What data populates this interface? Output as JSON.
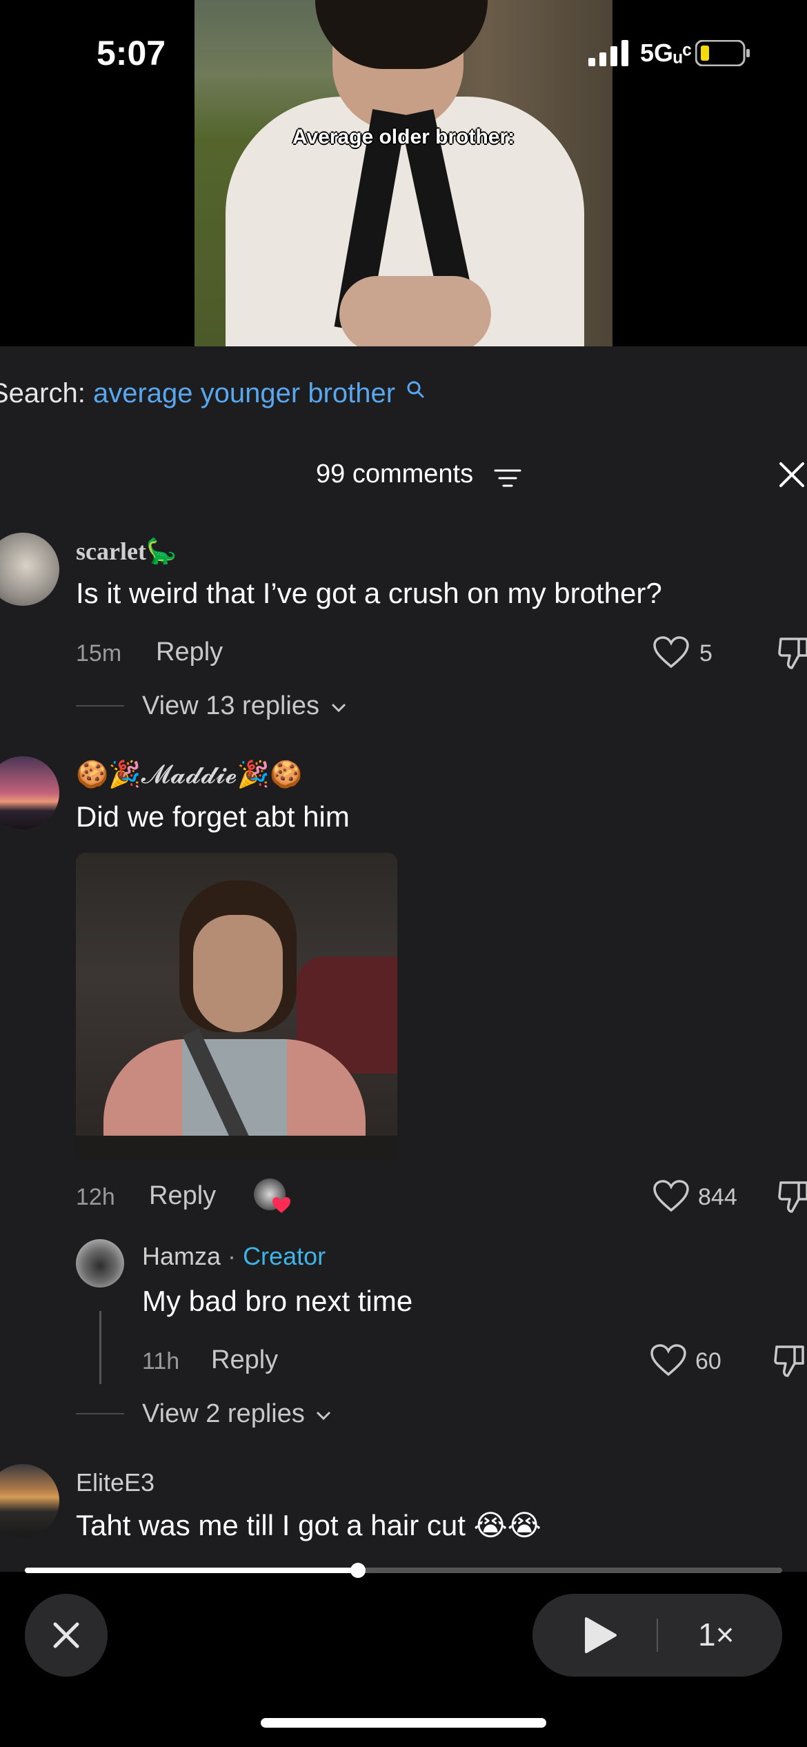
{
  "status_bar": {
    "time": "5:07",
    "network": "5Gᵤᶜ"
  },
  "video": {
    "caption": "Average older brother:"
  },
  "search": {
    "prefix": "Search:",
    "query": "average younger brother"
  },
  "comments_header": {
    "count_label": "99 comments"
  },
  "comments": [
    {
      "username": "scarlet🦕",
      "text": "Is it weird that I’ve got a crush on my brother?",
      "time": "15m",
      "reply_label": "Reply",
      "likes": "5",
      "view_replies": "View 13 replies"
    },
    {
      "username": "🍪🎉𝓜𝓪𝓭𝓭𝓲𝓮🎉🍪",
      "text": "Did we forget abt him",
      "time": "12h",
      "reply_label": "Reply",
      "likes": "844",
      "reply": {
        "username": "Hamza",
        "separator": "·",
        "badge": "Creator",
        "text": "My bad bro next time",
        "time": "11h",
        "reply_label": "Reply",
        "likes": "60"
      },
      "view_replies": "View 2 replies"
    },
    {
      "username": "EliteE3",
      "text": "Taht was me till I got a hair cut 😭😭"
    }
  ],
  "player": {
    "speed": "1×",
    "progress": 0.44
  },
  "colors": {
    "link_blue": "#58a7ef",
    "creator_badge": "#3fb4e6",
    "sheet_bg": "#1d1d1f"
  }
}
